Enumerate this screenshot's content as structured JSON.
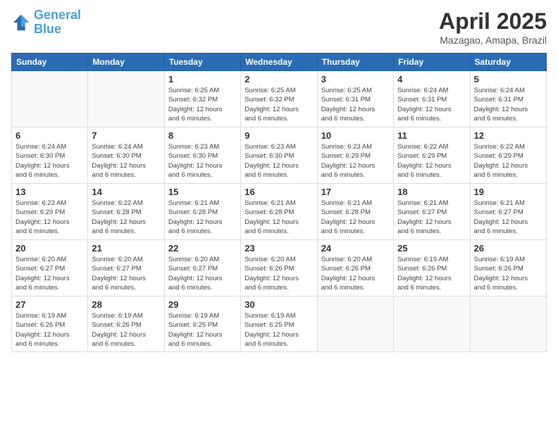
{
  "logo": {
    "line1": "General",
    "line2": "Blue"
  },
  "title": "April 2025",
  "location": "Mazagao, Amapa, Brazil",
  "days_header": [
    "Sunday",
    "Monday",
    "Tuesday",
    "Wednesday",
    "Thursday",
    "Friday",
    "Saturday"
  ],
  "weeks": [
    [
      {
        "day": "",
        "info": ""
      },
      {
        "day": "",
        "info": ""
      },
      {
        "day": "1",
        "info": "Sunrise: 6:25 AM\nSunset: 6:32 PM\nDaylight: 12 hours\nand 6 minutes."
      },
      {
        "day": "2",
        "info": "Sunrise: 6:25 AM\nSunset: 6:32 PM\nDaylight: 12 hours\nand 6 minutes."
      },
      {
        "day": "3",
        "info": "Sunrise: 6:25 AM\nSunset: 6:31 PM\nDaylight: 12 hours\nand 6 minutes."
      },
      {
        "day": "4",
        "info": "Sunrise: 6:24 AM\nSunset: 6:31 PM\nDaylight: 12 hours\nand 6 minutes."
      },
      {
        "day": "5",
        "info": "Sunrise: 6:24 AM\nSunset: 6:31 PM\nDaylight: 12 hours\nand 6 minutes."
      }
    ],
    [
      {
        "day": "6",
        "info": "Sunrise: 6:24 AM\nSunset: 6:30 PM\nDaylight: 12 hours\nand 6 minutes."
      },
      {
        "day": "7",
        "info": "Sunrise: 6:24 AM\nSunset: 6:30 PM\nDaylight: 12 hours\nand 6 minutes."
      },
      {
        "day": "8",
        "info": "Sunrise: 6:23 AM\nSunset: 6:30 PM\nDaylight: 12 hours\nand 6 minutes."
      },
      {
        "day": "9",
        "info": "Sunrise: 6:23 AM\nSunset: 6:30 PM\nDaylight: 12 hours\nand 6 minutes."
      },
      {
        "day": "10",
        "info": "Sunrise: 6:23 AM\nSunset: 6:29 PM\nDaylight: 12 hours\nand 6 minutes."
      },
      {
        "day": "11",
        "info": "Sunrise: 6:22 AM\nSunset: 6:29 PM\nDaylight: 12 hours\nand 6 minutes."
      },
      {
        "day": "12",
        "info": "Sunrise: 6:22 AM\nSunset: 6:29 PM\nDaylight: 12 hours\nand 6 minutes."
      }
    ],
    [
      {
        "day": "13",
        "info": "Sunrise: 6:22 AM\nSunset: 6:29 PM\nDaylight: 12 hours\nand 6 minutes."
      },
      {
        "day": "14",
        "info": "Sunrise: 6:22 AM\nSunset: 6:28 PM\nDaylight: 12 hours\nand 6 minutes."
      },
      {
        "day": "15",
        "info": "Sunrise: 6:21 AM\nSunset: 6:28 PM\nDaylight: 12 hours\nand 6 minutes."
      },
      {
        "day": "16",
        "info": "Sunrise: 6:21 AM\nSunset: 6:28 PM\nDaylight: 12 hours\nand 6 minutes."
      },
      {
        "day": "17",
        "info": "Sunrise: 6:21 AM\nSunset: 6:28 PM\nDaylight: 12 hours\nand 6 minutes."
      },
      {
        "day": "18",
        "info": "Sunrise: 6:21 AM\nSunset: 6:27 PM\nDaylight: 12 hours\nand 6 minutes."
      },
      {
        "day": "19",
        "info": "Sunrise: 6:21 AM\nSunset: 6:27 PM\nDaylight: 12 hours\nand 6 minutes."
      }
    ],
    [
      {
        "day": "20",
        "info": "Sunrise: 6:20 AM\nSunset: 6:27 PM\nDaylight: 12 hours\nand 6 minutes."
      },
      {
        "day": "21",
        "info": "Sunrise: 6:20 AM\nSunset: 6:27 PM\nDaylight: 12 hours\nand 6 minutes."
      },
      {
        "day": "22",
        "info": "Sunrise: 6:20 AM\nSunset: 6:27 PM\nDaylight: 12 hours\nand 6 minutes."
      },
      {
        "day": "23",
        "info": "Sunrise: 6:20 AM\nSunset: 6:26 PM\nDaylight: 12 hours\nand 6 minutes."
      },
      {
        "day": "24",
        "info": "Sunrise: 6:20 AM\nSunset: 6:26 PM\nDaylight: 12 hours\nand 6 minutes."
      },
      {
        "day": "25",
        "info": "Sunrise: 6:19 AM\nSunset: 6:26 PM\nDaylight: 12 hours\nand 6 minutes."
      },
      {
        "day": "26",
        "info": "Sunrise: 6:19 AM\nSunset: 6:26 PM\nDaylight: 12 hours\nand 6 minutes."
      }
    ],
    [
      {
        "day": "27",
        "info": "Sunrise: 6:19 AM\nSunset: 6:26 PM\nDaylight: 12 hours\nand 6 minutes."
      },
      {
        "day": "28",
        "info": "Sunrise: 6:19 AM\nSunset: 6:26 PM\nDaylight: 12 hours\nand 6 minutes."
      },
      {
        "day": "29",
        "info": "Sunrise: 6:19 AM\nSunset: 6:25 PM\nDaylight: 12 hours\nand 6 minutes."
      },
      {
        "day": "30",
        "info": "Sunrise: 6:19 AM\nSunset: 6:25 PM\nDaylight: 12 hours\nand 6 minutes."
      },
      {
        "day": "",
        "info": ""
      },
      {
        "day": "",
        "info": ""
      },
      {
        "day": "",
        "info": ""
      }
    ]
  ]
}
